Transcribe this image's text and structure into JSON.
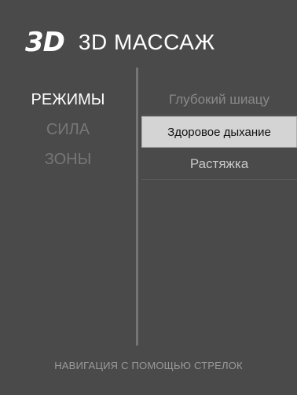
{
  "header": {
    "logo": "3D",
    "title": "3D МАССАЖ"
  },
  "menu": {
    "items": [
      {
        "label": "РЕЖИМЫ",
        "active": true
      },
      {
        "label": "СИЛА",
        "active": false
      },
      {
        "label": "ЗОНЫ",
        "active": false
      }
    ]
  },
  "options": {
    "items": [
      {
        "label": "Глубокий шиацу",
        "state": "faded"
      },
      {
        "label": "Здоровое дыхание",
        "state": "selected"
      },
      {
        "label": "Растяжка",
        "state": "normal"
      }
    ]
  },
  "footer": {
    "hint": "НАВИГАЦИЯ С ПОМОЩЬЮ СТРЕЛОК"
  },
  "colors": {
    "background": "#4a4a4a",
    "selected_bg": "#d4d4d4",
    "active_text": "#ffffff",
    "inactive_text": "#777777"
  }
}
